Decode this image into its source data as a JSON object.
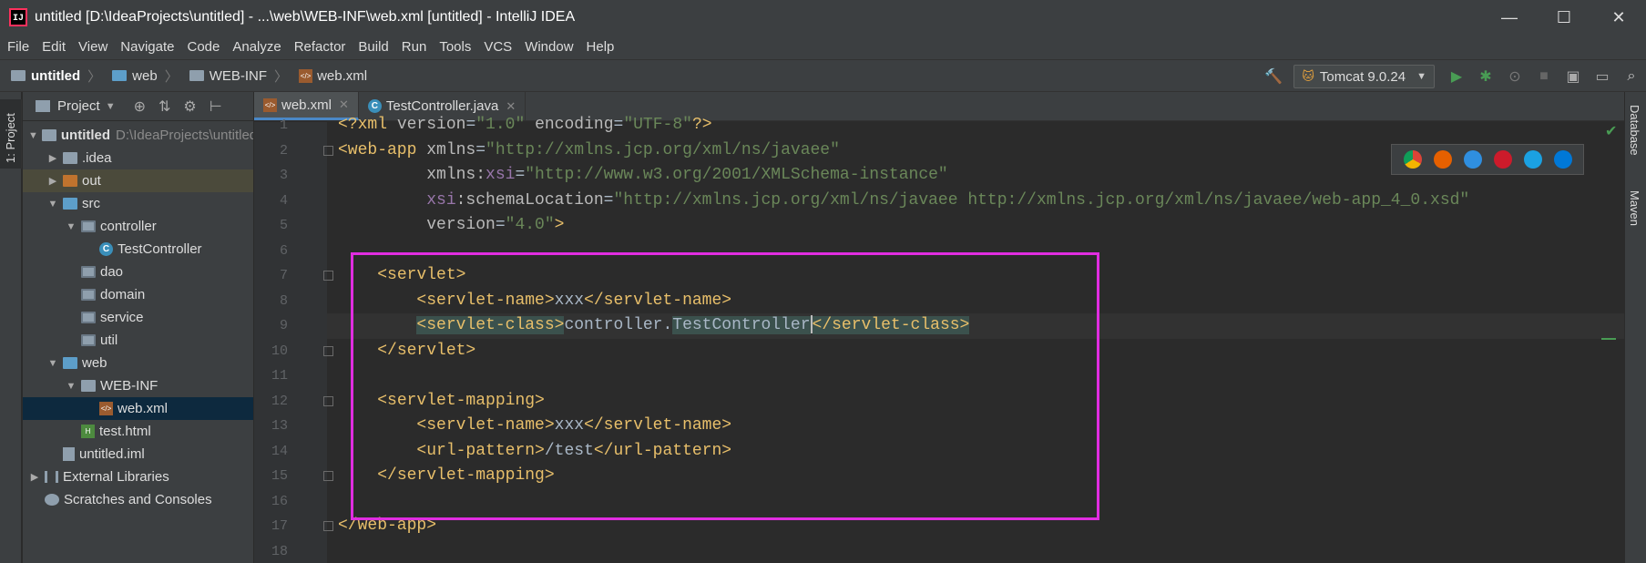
{
  "window": {
    "title": "untitled [D:\\IdeaProjects\\untitled] - ...\\web\\WEB-INF\\web.xml [untitled] - IntelliJ IDEA",
    "app_icon_letters": "IJ",
    "minimize": "—",
    "maximize": "☐",
    "close": "✕"
  },
  "menu": [
    "File",
    "Edit",
    "View",
    "Navigate",
    "Code",
    "Analyze",
    "Refactor",
    "Build",
    "Run",
    "Tools",
    "VCS",
    "Window",
    "Help"
  ],
  "breadcrumb": [
    "untitled",
    "web",
    "WEB-INF",
    "web.xml"
  ],
  "run_config": {
    "label": "Tomcat 9.0.24"
  },
  "project_panel": {
    "title": "Project",
    "tree": [
      {
        "label": "untitled",
        "extra": "D:\\IdeaProjects\\untitled"
      },
      {
        "label": ".idea"
      },
      {
        "label": "out"
      },
      {
        "label": "src"
      },
      {
        "label": "controller"
      },
      {
        "label": "TestController"
      },
      {
        "label": "dao"
      },
      {
        "label": "domain"
      },
      {
        "label": "service"
      },
      {
        "label": "util"
      },
      {
        "label": "web"
      },
      {
        "label": "WEB-INF"
      },
      {
        "label": "web.xml"
      },
      {
        "label": "test.html"
      },
      {
        "label": "untitled.iml"
      },
      {
        "label": "External Libraries"
      },
      {
        "label": "Scratches and Consoles"
      }
    ]
  },
  "left_tool_tab": "1: Project",
  "right_tool_tabs": [
    "Database",
    "Maven"
  ],
  "editor_tabs": [
    {
      "label": "web.xml",
      "active": true
    },
    {
      "label": "TestController.java",
      "active": false
    }
  ],
  "code": {
    "line_numbers": [
      "1",
      "2",
      "3",
      "4",
      "5",
      "6",
      "7",
      "8",
      "9",
      "10",
      "11",
      "12",
      "13",
      "14",
      "15",
      "16",
      "17",
      "18"
    ],
    "current_line": 9,
    "lines": [
      [
        [
          "tag",
          "<?xml "
        ],
        [
          "attr",
          "version"
        ],
        [
          "plain",
          "="
        ],
        [
          "val",
          "\"1.0\""
        ],
        [
          "plain",
          " "
        ],
        [
          "attr",
          "encoding"
        ],
        [
          "plain",
          "="
        ],
        [
          "val",
          "\"UTF-8\""
        ],
        [
          "tag",
          "?>"
        ]
      ],
      [
        [
          "tag",
          "<web-app "
        ],
        [
          "attr",
          "xmlns"
        ],
        [
          "plain",
          "="
        ],
        [
          "val",
          "\"http://xmlns.jcp.org/xml/ns/javaee\""
        ]
      ],
      [
        [
          "plain",
          "         "
        ],
        [
          "attr",
          "xmlns:"
        ],
        [
          "ns",
          "xsi"
        ],
        [
          "plain",
          "="
        ],
        [
          "val",
          "\"http://www.w3.org/2001/XMLSchema-instance\""
        ]
      ],
      [
        [
          "plain",
          "         "
        ],
        [
          "ns",
          "xsi"
        ],
        [
          "attr",
          ":schemaLocation"
        ],
        [
          "plain",
          "="
        ],
        [
          "val",
          "\"http://xmlns.jcp.org/xml/ns/javaee http://xmlns.jcp.org/xml/ns/javaee/web-app_4_0.xsd\""
        ]
      ],
      [
        [
          "plain",
          "         "
        ],
        [
          "attr",
          "version"
        ],
        [
          "plain",
          "="
        ],
        [
          "val",
          "\"4.0\""
        ],
        [
          "tag",
          ">"
        ]
      ],
      [],
      [
        [
          "plain",
          "    "
        ],
        [
          "tag",
          "<servlet>"
        ]
      ],
      [
        [
          "plain",
          "        "
        ],
        [
          "tag",
          "<servlet-name>"
        ],
        [
          "plain",
          "xxx"
        ],
        [
          "tag",
          "</servlet-name>"
        ]
      ],
      [
        [
          "plain",
          "        "
        ],
        [
          "taghl",
          "<servlet-class>"
        ],
        [
          "plain",
          "controller."
        ],
        [
          "hlp",
          "TestController"
        ],
        [
          "caret",
          ""
        ],
        [
          "taghl",
          "</servlet-class>"
        ]
      ],
      [
        [
          "plain",
          "    "
        ],
        [
          "tag",
          "</servlet>"
        ]
      ],
      [],
      [
        [
          "plain",
          "    "
        ],
        [
          "tag",
          "<servlet-mapping>"
        ]
      ],
      [
        [
          "plain",
          "        "
        ],
        [
          "tag",
          "<servlet-name>"
        ],
        [
          "plain",
          "xxx"
        ],
        [
          "tag",
          "</servlet-name>"
        ]
      ],
      [
        [
          "plain",
          "        "
        ],
        [
          "tag",
          "<url-pattern>"
        ],
        [
          "plain",
          "/test"
        ],
        [
          "tag",
          "</url-pattern>"
        ]
      ],
      [
        [
          "plain",
          "    "
        ],
        [
          "tag",
          "</servlet-mapping>"
        ]
      ],
      [],
      [
        [
          "tag",
          "</web-app>"
        ]
      ],
      []
    ]
  },
  "colors": {
    "highlight_box": "#e02de0",
    "accent": "#4a88c7",
    "tag": "#e8bf6a",
    "string": "#6a8759"
  },
  "browser_icons": [
    "chrome-icon",
    "firefox-icon",
    "safari-icon",
    "opera-icon",
    "ie-icon",
    "edge-icon"
  ]
}
